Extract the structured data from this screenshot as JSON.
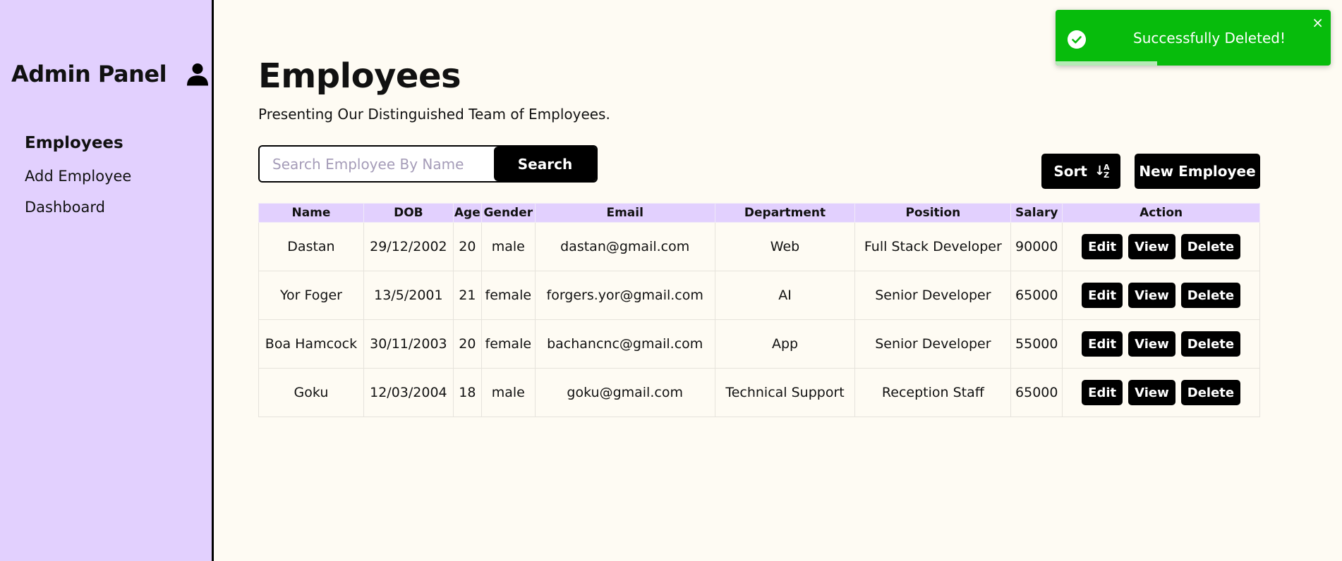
{
  "sidebar": {
    "title": "Admin Panel",
    "items": [
      {
        "label": "Employees"
      },
      {
        "label": "Add Employee"
      },
      {
        "label": "Dashboard"
      }
    ]
  },
  "header": {
    "title": "Employees",
    "subtitle": "Presenting Our Distinguished Team of Employees."
  },
  "search": {
    "placeholder": "Search Employee By Name",
    "value": "",
    "button_label": "Search"
  },
  "toolbar": {
    "sort_label": "Sort",
    "sort_icon": "sort-az-icon",
    "new_label": "New Employee"
  },
  "table": {
    "columns": [
      "Name",
      "DOB",
      "Age",
      "Gender",
      "Email",
      "Department",
      "Position",
      "Salary",
      "Action"
    ],
    "action_labels": {
      "edit": "Edit",
      "view": "View",
      "delete": "Delete"
    },
    "rows": [
      [
        "Dastan",
        "29/12/2002",
        "20",
        "male",
        "dastan@gmail.com",
        "Web",
        "Full Stack Developer",
        "90000"
      ],
      [
        "Yor Foger",
        "13/5/2001",
        "21",
        "female",
        "forgers.yor@gmail.com",
        "AI",
        "Senior Developer",
        "65000"
      ],
      [
        "Boa Hamcock",
        "30/11/2003",
        "20",
        "female",
        "bachancnc@gmail.com",
        "App",
        "Senior Developer",
        "55000"
      ],
      [
        "Goku",
        "12/03/2004",
        "18",
        "male",
        "goku@gmail.com",
        "Technical Support",
        "Reception Staff",
        "65000"
      ]
    ]
  },
  "toast": {
    "message": "Successfully Deleted!",
    "close_glyph": "×",
    "progress_remaining": 0.37,
    "color": "#07bc0c"
  },
  "colors": {
    "sidebar_bg": "#e2d0fe",
    "page_bg": "#fefbf3",
    "button_bg": "#000000"
  }
}
